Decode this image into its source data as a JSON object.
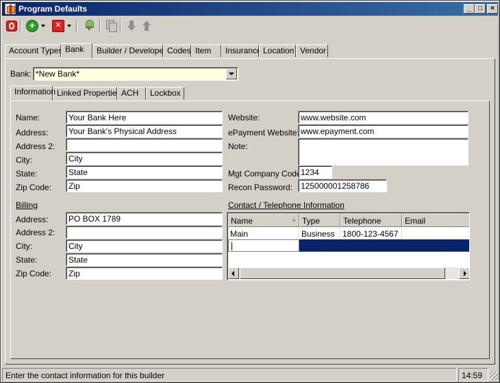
{
  "window": {
    "title": "Program Defaults",
    "controls": {
      "minimize": "_",
      "maximize": "□",
      "close": "×"
    }
  },
  "toolbar": {
    "icons": [
      "power-icon",
      "add-icon",
      "dropdown-arrow-icon",
      "delete-icon",
      "dropdown-arrow-icon",
      "download-icon",
      "copy-icon",
      "move-down-icon",
      "move-up-icon"
    ]
  },
  "main_tabs": [
    {
      "label": "Account Types"
    },
    {
      "label": "Bank",
      "active": true
    },
    {
      "label": "Builder / Developer"
    },
    {
      "label": "Codes"
    },
    {
      "label": "Item"
    },
    {
      "label": "Insurance"
    },
    {
      "label": "Location"
    },
    {
      "label": "Vendor"
    }
  ],
  "bank_selector": {
    "label": "Bank:",
    "value": "*New Bank*"
  },
  "sub_tabs": [
    {
      "label": "Information",
      "active": true
    },
    {
      "label": "Linked Properties"
    },
    {
      "label": "ACH"
    },
    {
      "label": "Lockbox"
    }
  ],
  "info": {
    "name_label": "Name:",
    "name": "Your Bank Here",
    "address_label": "Address:",
    "address": "Your Bank's Physical Address",
    "address2_label": "Address 2:",
    "address2": "",
    "city_label": "City:",
    "city": "City",
    "state_label": "State:",
    "state": "State",
    "zip_label": "Zip Code:",
    "zip": "Zip"
  },
  "billing": {
    "heading": "Billing",
    "address_label": "Address:",
    "address": "PO BOX 1789",
    "address2_label": "Address 2:",
    "address2": "",
    "city_label": "City:",
    "city": "City",
    "state_label": "State:",
    "state": "State",
    "zip_label": "Zip Code:",
    "zip": "Zip"
  },
  "web": {
    "website_label": "Website:",
    "website": "www.website.com",
    "epayment_label": "ePayment Website:",
    "epayment": "www.epayment.com",
    "note_label": "Note:",
    "note": "",
    "mgt_code_label": "Mgt Company Code:",
    "mgt_code": "1234",
    "recon_label": "Recon Password:",
    "recon": "125000001258786"
  },
  "contacts": {
    "heading": "Contact / Telephone Information",
    "columns": [
      "Name",
      "Type",
      "Telephone",
      "Email"
    ],
    "rows": [
      {
        "name": "Main",
        "type": "Business",
        "telephone": "1800-123-4567",
        "email": ""
      }
    ]
  },
  "status": {
    "message": "Enter the contact information for this builder",
    "time": "14:59"
  }
}
